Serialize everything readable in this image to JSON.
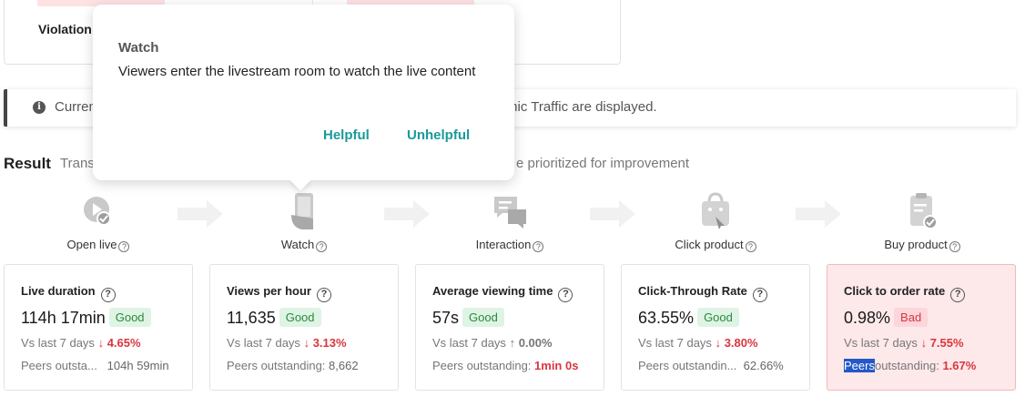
{
  "top_card": {
    "violation_label": "Violation"
  },
  "notice": {
    "text_start": "Curren",
    "text_end": "mic Traffic are displayed."
  },
  "result": {
    "title": "Result",
    "desc_start": "Trans",
    "desc_end": "e prioritized for improvement"
  },
  "steps": [
    {
      "label": "Open live",
      "icon": "play-icon"
    },
    {
      "label": "Watch",
      "icon": "phone-icon"
    },
    {
      "label": "Interaction",
      "icon": "chat-icon"
    },
    {
      "label": "Click product",
      "icon": "shopping-bag-icon"
    },
    {
      "label": "Buy product",
      "icon": "clipboard-check-icon"
    }
  ],
  "metrics": [
    {
      "title": "Live duration",
      "value": "114h 17min",
      "status": "Good",
      "vs_label": "Vs last 7 days",
      "change": "4.65%",
      "change_dir": "down",
      "peers_label": "Peers outsta...",
      "peers_value": "104h 59min"
    },
    {
      "title": "Views per hour",
      "value": "11,635",
      "status": "Good",
      "vs_label": "Vs last 7 days",
      "change": "3.13%",
      "change_dir": "down",
      "peers_label": "Peers outstanding:",
      "peers_value": "8,662"
    },
    {
      "title": "Average viewing time",
      "value": "57s",
      "status": "Good",
      "vs_label": "Vs last 7 days",
      "change": "0.00%",
      "change_dir": "flat",
      "peers_label": "Peers outstanding:",
      "peers_value": "1min 0s"
    },
    {
      "title": "Click-Through Rate",
      "value": "63.55%",
      "status": "Good",
      "vs_label": "Vs last 7 days",
      "change": "3.80%",
      "change_dir": "down",
      "peers_label": "Peers outstandin...",
      "peers_value": "62.66%"
    },
    {
      "title": "Click to order rate",
      "value": "0.98%",
      "status": "Bad",
      "vs_label": "Vs last 7 days",
      "change": "7.55%",
      "change_dir": "down",
      "peers_label_highlight": "Peers",
      "peers_label_rest": "outstanding:",
      "peers_value": "1.67%"
    }
  ],
  "popup": {
    "title": "Watch",
    "body": "Viewers enter the livestream room to watch the live content",
    "helpful": "Helpful",
    "unhelpful": "Unhelpful"
  },
  "colors": {
    "good_bg": "#dff4e4",
    "good_text": "#2b8a3e",
    "bad_bg": "#fcd6da",
    "bad_text": "#d9363e",
    "accent_teal": "#1a9a9a",
    "highlight": "#2458c9"
  }
}
